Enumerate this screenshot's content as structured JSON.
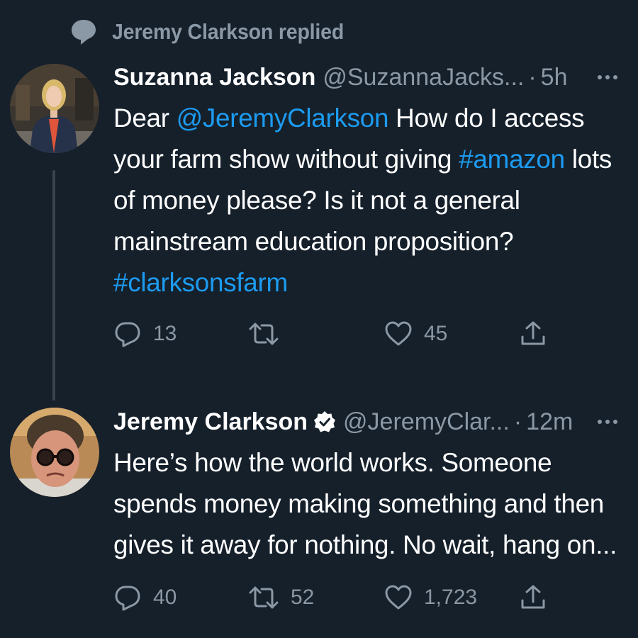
{
  "social_context": {
    "text": "Jeremy Clarkson replied",
    "icon": "speech-bubble-icon"
  },
  "tweets": [
    {
      "name": "Suzanna Jackson",
      "handle": "@SuzannaJacks...",
      "separator": "·",
      "time": "5h",
      "verified": false,
      "body": {
        "l1_a": "Dear ",
        "l1_mention": "@JeremyClarkson",
        "l1_b": " How do I access",
        "l2_a": "your farm show without giving ",
        "l2_hashtag": "#amazon",
        "l2_b": " lots",
        "l3": "of money please? Is it not a general",
        "l4": "mainstream education proposition?",
        "l5_hashtag": "#clarksonsfarm"
      },
      "actions": {
        "replies": "13",
        "retweets": "",
        "likes": "45"
      }
    },
    {
      "name": "Jeremy Clarkson",
      "handle": "@JeremyClar...",
      "separator": "·",
      "time": "12m",
      "verified": true,
      "body": {
        "l1": "Here’s how the world works. Someone",
        "l2": "spends money making something and then",
        "l3": "gives it away for nothing. No wait, hang on..."
      },
      "actions": {
        "replies": "40",
        "retweets": "52",
        "likes": "1,723"
      }
    }
  ],
  "colors": {
    "background": "#15202b",
    "text": "#ffffff",
    "secondary": "#8b98a5",
    "link": "#1d9bf0"
  }
}
